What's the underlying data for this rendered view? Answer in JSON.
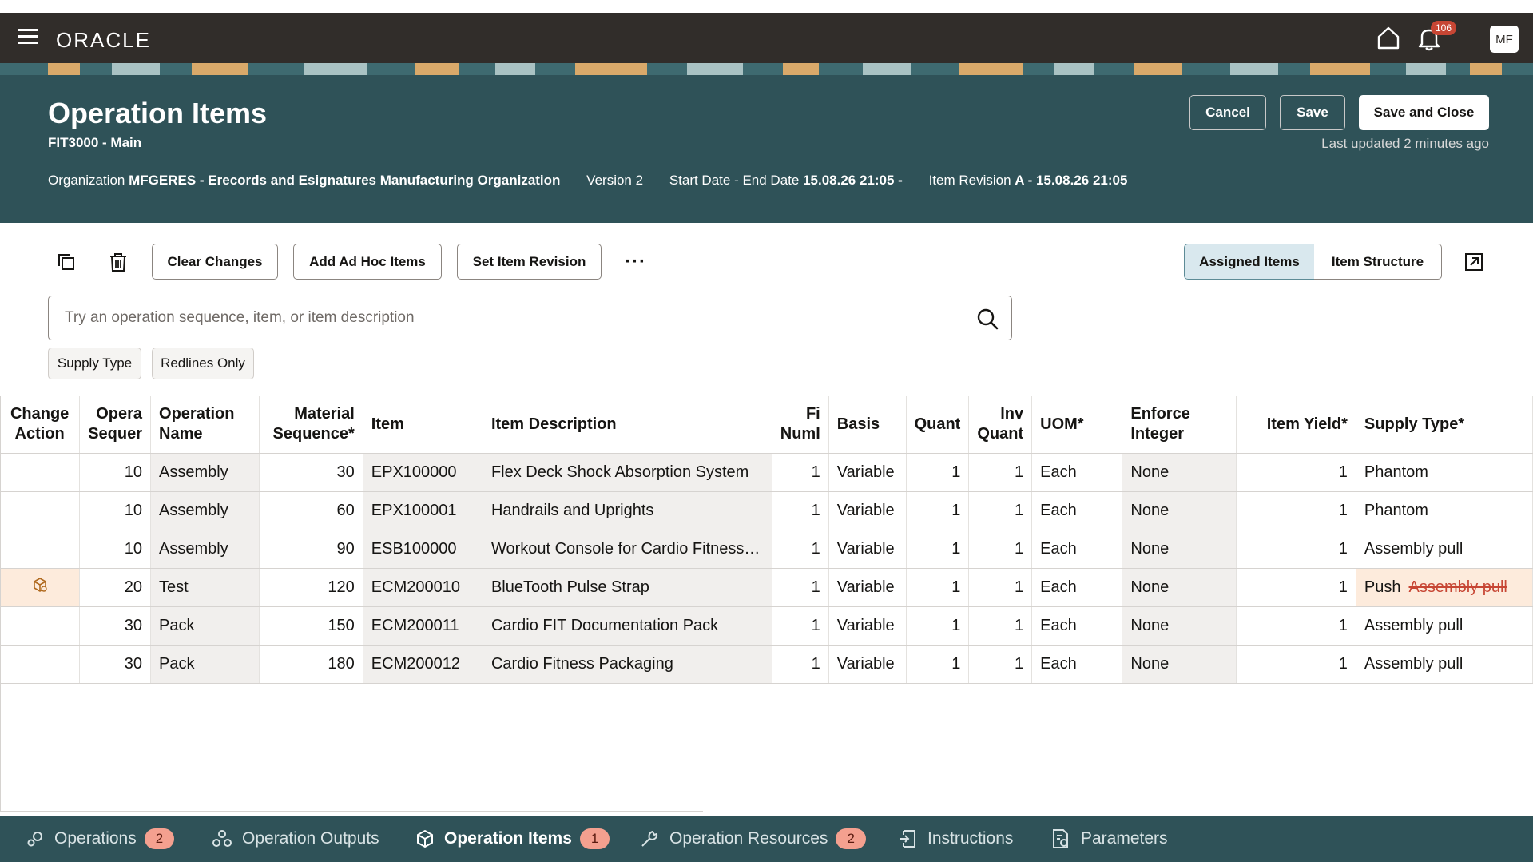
{
  "appbar": {
    "logo": "ORACLE",
    "notifications": "106",
    "user_initials": "MF"
  },
  "header": {
    "title": "Operation Items",
    "subtitle": "FIT3000 - Main",
    "cancel_label": "Cancel",
    "save_label": "Save",
    "save_close_label": "Save and Close",
    "last_updated": "Last updated 2 minutes ago",
    "org_label": "Organization",
    "org_value": "MFGERES - Erecords and Esignatures Manufacturing Organization",
    "version_label": "Version",
    "version_value": "2",
    "dates_label": "Start Date - End Date",
    "dates_value": "15.08.26 21:05 -",
    "revision_label": "Item Revision",
    "revision_value": "A - 15.08.26 21:05"
  },
  "toolbar": {
    "clear_changes": "Clear Changes",
    "add_adhoc": "Add Ad Hoc Items",
    "set_revision": "Set Item Revision",
    "more": "···",
    "assigned_items": "Assigned Items",
    "item_structure": "Item Structure"
  },
  "search": {
    "placeholder": "Try an operation sequence, item, or item description"
  },
  "filters": {
    "supply_type": "Supply Type",
    "redlines_only": "Redlines Only"
  },
  "table": {
    "headers": {
      "change_action_1": "Change",
      "change_action_2": "Action",
      "op_seq_1": "Opera",
      "op_seq_2": "Sequer",
      "op_name_1": "Operation",
      "op_name_2": "Name",
      "mat_seq_1": "Material",
      "mat_seq_2": "Sequence*",
      "item": "Item",
      "item_desc": "Item Description",
      "fixed_1": "Fi",
      "fixed_2": "Numl",
      "basis": "Basis",
      "quantity": "Quant",
      "inv_qty_1": "Inv",
      "inv_qty_2": "Quant",
      "uom": "UOM*",
      "enforce_1": "Enforce",
      "enforce_2": "Integer",
      "yield": "Item Yield*",
      "supply": "Supply Type*"
    },
    "rows": [
      {
        "op_seq": "10",
        "op_name": "Assembly",
        "mat_seq": "30",
        "item": "EPX100000",
        "desc": "Flex Deck Shock Absorption System",
        "fixed": "1",
        "basis": "Variable",
        "qty": "1",
        "inv_qty": "1",
        "uom": "Each",
        "enforce": "None",
        "yield": "1",
        "supply": "Phantom",
        "supply_old": ""
      },
      {
        "op_seq": "10",
        "op_name": "Assembly",
        "mat_seq": "60",
        "item": "EPX100001",
        "desc": "Handrails and Uprights",
        "fixed": "1",
        "basis": "Variable",
        "qty": "1",
        "inv_qty": "1",
        "uom": "Each",
        "enforce": "None",
        "yield": "1",
        "supply": "Phantom",
        "supply_old": ""
      },
      {
        "op_seq": "10",
        "op_name": "Assembly",
        "mat_seq": "90",
        "item": "ESB100000",
        "desc": "Workout Console for Cardio Fitness…",
        "fixed": "1",
        "basis": "Variable",
        "qty": "1",
        "inv_qty": "1",
        "uom": "Each",
        "enforce": "None",
        "yield": "1",
        "supply": "Assembly pull",
        "supply_old": ""
      },
      {
        "op_seq": "20",
        "op_name": "Test",
        "mat_seq": "120",
        "item": "ECM200010",
        "desc": "BlueTooth Pulse Strap",
        "fixed": "1",
        "basis": "Variable",
        "qty": "1",
        "inv_qty": "1",
        "uom": "Each",
        "enforce": "None",
        "yield": "1",
        "supply": "Push",
        "supply_old": "Assembly pull"
      },
      {
        "op_seq": "30",
        "op_name": "Pack",
        "mat_seq": "150",
        "item": "ECM200011",
        "desc": "Cardio FIT Documentation Pack",
        "fixed": "1",
        "basis": "Variable",
        "qty": "1",
        "inv_qty": "1",
        "uom": "Each",
        "enforce": "None",
        "yield": "1",
        "supply": "Assembly pull",
        "supply_old": ""
      },
      {
        "op_seq": "30",
        "op_name": "Pack",
        "mat_seq": "180",
        "item": "ECM200012",
        "desc": "Cardio Fitness Packaging",
        "fixed": "1",
        "basis": "Variable",
        "qty": "1",
        "inv_qty": "1",
        "uom": "Each",
        "enforce": "None",
        "yield": "1",
        "supply": "Assembly pull",
        "supply_old": ""
      }
    ]
  },
  "tabs": [
    {
      "label": "Operations",
      "count": "2",
      "icon": "gears-icon"
    },
    {
      "label": "Operation Outputs",
      "count": "",
      "icon": "outputs-icon"
    },
    {
      "label": "Operation Items",
      "count": "1",
      "icon": "cube-icon"
    },
    {
      "label": "Operation Resources",
      "count": "2",
      "icon": "wrench-icon"
    },
    {
      "label": "Instructions",
      "count": "",
      "icon": "instructions-icon"
    },
    {
      "label": "Parameters",
      "count": "",
      "icon": "parameters-icon"
    }
  ],
  "colors": {
    "appbar": "#312d2a",
    "banner": "#2f5258",
    "accent_badge": "#c74634",
    "changed_row": "#fdebdc"
  }
}
